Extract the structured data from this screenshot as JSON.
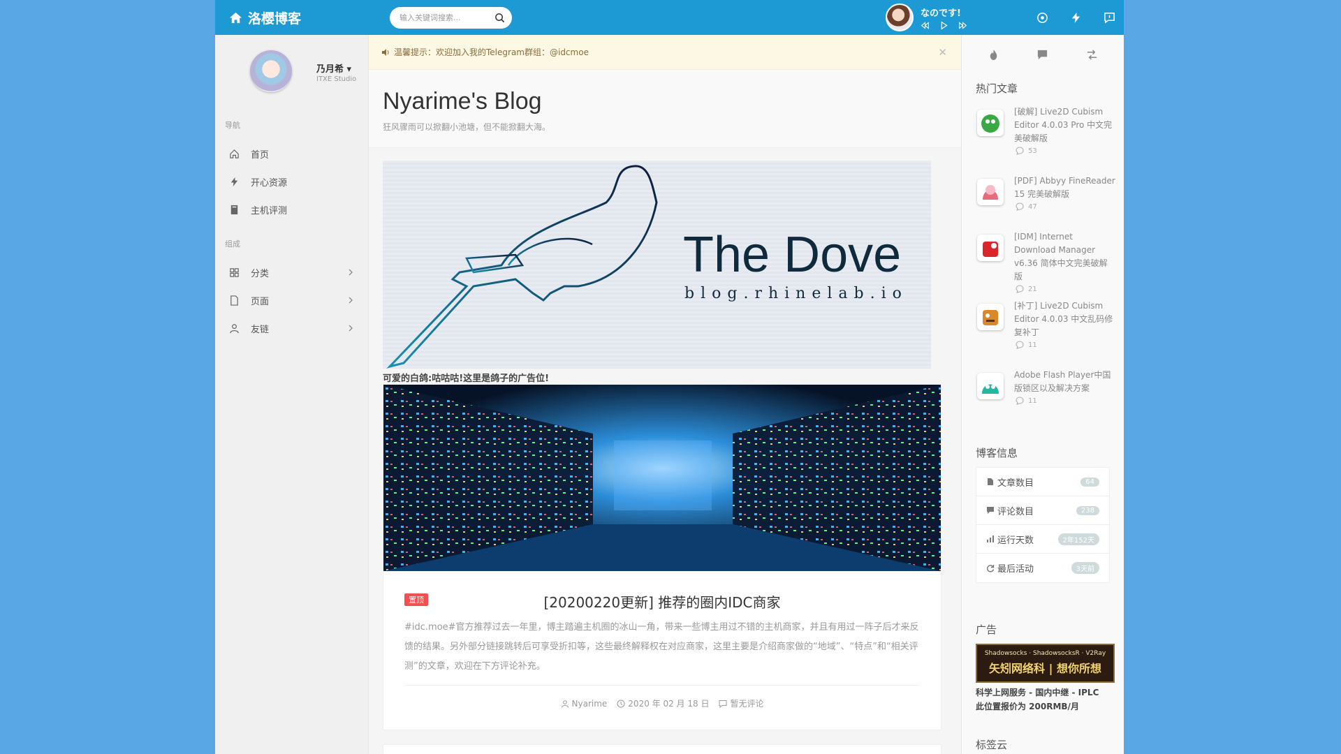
{
  "header": {
    "brand": "洛樱博客",
    "search_placeholder": "输入关键词搜索...",
    "player_title": "なのです!"
  },
  "left": {
    "user_name": "乃月希",
    "user_studio": "ITXE Studio",
    "nav_heading": "导航",
    "nav_items": [
      "首页",
      "开心资源",
      "主机评测"
    ],
    "group_heading": "组成",
    "group_items": [
      "分类",
      "页面",
      "友链"
    ]
  },
  "notice": "温馨提示：欢迎加入我的Telegram群组：@idcmoe",
  "blog": {
    "title": "Nyarime's Blog",
    "subtitle": "狂风骤雨可以掀翻小池塘，但不能掀翻大海。"
  },
  "banner": {
    "title": "The Dove",
    "url": "blog.rhinelab.io",
    "caption": "可爱的白鸽:咕咕咕!这里是鸽子的广告位!"
  },
  "post": {
    "badge": "置顶",
    "title": "[20200220更新] 推荐的圈内IDC商家",
    "excerpt": "#idc.moe#官方推荐过去一年里，博主踏遍主机圈的冰山一角，带来一些博主用过不错的主机商家，并且有用过一阵子后才来反馈的结果。另外部分链接跳转后可享受折扣等，这些最终解释权在对应商家，这里主要是介绍商家做的“地域”、“特点”和“相关评测”的文章，欢迎在下方评论补充。",
    "author": "Nyarime",
    "date": "2020 年 02 月 18 日",
    "comments": "暂无评论"
  },
  "right": {
    "hot_title": "热门文章",
    "hot_items": [
      {
        "title": "[破解] Live2D Cubism Editor 4.0.03 Pro 中文完美破解版",
        "count": "53",
        "color": "#3aa845"
      },
      {
        "title": "[PDF] Abbyy FineReader 15 完美破解版",
        "count": "47",
        "color": "#e86b7d"
      },
      {
        "title": "[IDM] Internet Download Manager v6.36 简体中文完美破解版",
        "count": "21",
        "color": "#d9262b"
      },
      {
        "title": "[补丁] Live2D Cubism Editor 4.0.03 中文乱码修复补丁",
        "count": "11",
        "color": "#d88a2a"
      },
      {
        "title": "Adobe Flash Player中国版锁区以及解决方案",
        "count": "11",
        "color": "#26b7a3"
      }
    ],
    "info_title": "博客信息",
    "stats": [
      {
        "label": "文章数目",
        "value": "64"
      },
      {
        "label": "评论数目",
        "value": "238"
      },
      {
        "label": "运行天数",
        "value": "2年152天"
      },
      {
        "label": "最后活动",
        "value": "3天前"
      }
    ],
    "ad_title": "广告",
    "ad_line1": "Shadowsocks · ShadowsocksR · V2Ray",
    "ad_line2": "矢矧网络科 | 想你所想",
    "ad_caption": "科学上网服务 - 国内中继 - IPLC 此位置报价为 200RMB/月",
    "tags_title": "标签云"
  }
}
